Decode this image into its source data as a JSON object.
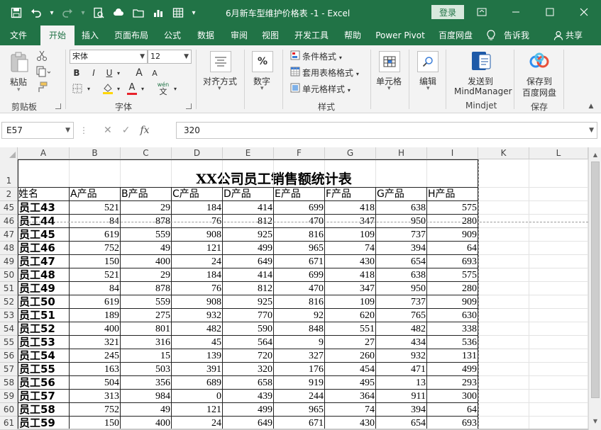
{
  "window": {
    "title": "6月新车型维护价格表 -1 - Excel",
    "login_label": "登录"
  },
  "tabs": [
    "文件",
    "开始",
    "插入",
    "页面布局",
    "公式",
    "数据",
    "审阅",
    "视图",
    "开发工具",
    "帮助",
    "Power Pivot",
    "百度网盘",
    "告诉我",
    "共享"
  ],
  "ribbon": {
    "paste": "粘贴",
    "clipboard": "剪贴板",
    "font_name": "宋体",
    "font_size": "12",
    "font_group": "字体",
    "bold": "B",
    "italic": "I",
    "underline": "U",
    "grow_font": "A",
    "shrink_font": "A",
    "font_color_letter": "A",
    "wen": "wén",
    "wen_char": "文",
    "align": "对齐方式",
    "number": "数字",
    "percent": "%",
    "cond_format": "条件格式",
    "table_format": "套用表格格式",
    "cell_style": "单元格样式",
    "styles_group": "样式",
    "cells": "单元格",
    "editing": "编辑",
    "mindmanager_line1": "发送到",
    "mindmanager_line2": "MindManager",
    "mindjet": "Mindjet",
    "baidu_line1": "保存到",
    "baidu_line2": "百度网盘",
    "save_group": "保存"
  },
  "formula_bar": {
    "cell_ref": "E57",
    "fx": "fx",
    "value": "320"
  },
  "columns": [
    "A",
    "B",
    "C",
    "D",
    "E",
    "F",
    "G",
    "H",
    "I",
    "K",
    "L"
  ],
  "sheet": {
    "title": "XX公司员工销售额统计表",
    "headers": [
      "姓名",
      "A产品",
      "B产品",
      "C产品",
      "D产品",
      "E产品",
      "F产品",
      "G产品",
      "H产品"
    ],
    "row_numbers": [
      "1",
      "2",
      "45",
      "46",
      "47",
      "48",
      "49",
      "50",
      "51",
      "52",
      "53",
      "54",
      "55",
      "56",
      "57",
      "58",
      "59",
      "60",
      "61"
    ],
    "rows": [
      {
        "name": "员工43",
        "values": [
          521,
          29,
          184,
          414,
          699,
          418,
          638,
          575
        ]
      },
      {
        "name": "员工44",
        "values": [
          84,
          878,
          76,
          812,
          470,
          347,
          950,
          280
        ]
      },
      {
        "name": "员工45",
        "values": [
          619,
          559,
          908,
          925,
          816,
          109,
          737,
          909
        ]
      },
      {
        "name": "员工46",
        "values": [
          752,
          49,
          121,
          499,
          965,
          74,
          394,
          64
        ]
      },
      {
        "name": "员工47",
        "values": [
          150,
          400,
          24,
          649,
          671,
          430,
          654,
          693
        ]
      },
      {
        "name": "员工48",
        "values": [
          521,
          29,
          184,
          414,
          699,
          418,
          638,
          575
        ]
      },
      {
        "name": "员工49",
        "values": [
          84,
          878,
          76,
          812,
          470,
          347,
          950,
          280
        ]
      },
      {
        "name": "员工50",
        "values": [
          619,
          559,
          908,
          925,
          816,
          109,
          737,
          909
        ]
      },
      {
        "name": "员工51",
        "values": [
          189,
          275,
          932,
          770,
          92,
          620,
          765,
          630
        ]
      },
      {
        "name": "员工52",
        "values": [
          400,
          801,
          482,
          590,
          848,
          551,
          482,
          338
        ]
      },
      {
        "name": "员工53",
        "values": [
          321,
          316,
          45,
          564,
          9,
          27,
          434,
          536
        ]
      },
      {
        "name": "员工54",
        "values": [
          245,
          15,
          139,
          720,
          327,
          260,
          932,
          131
        ]
      },
      {
        "name": "员工55",
        "values": [
          163,
          503,
          391,
          320,
          176,
          454,
          471,
          499
        ]
      },
      {
        "name": "员工56",
        "values": [
          504,
          356,
          689,
          658,
          919,
          495,
          13,
          293
        ]
      },
      {
        "name": "员工57",
        "values": [
          313,
          984,
          0,
          439,
          244,
          364,
          911,
          300
        ]
      },
      {
        "name": "员工58",
        "values": [
          752,
          49,
          121,
          499,
          965,
          74,
          394,
          64
        ]
      },
      {
        "name": "员工59",
        "values": [
          150,
          400,
          24,
          649,
          671,
          430,
          654,
          693
        ]
      }
    ]
  },
  "colors": {
    "excel_green": "#217346",
    "ribbon_bg": "#f3f3f3"
  }
}
